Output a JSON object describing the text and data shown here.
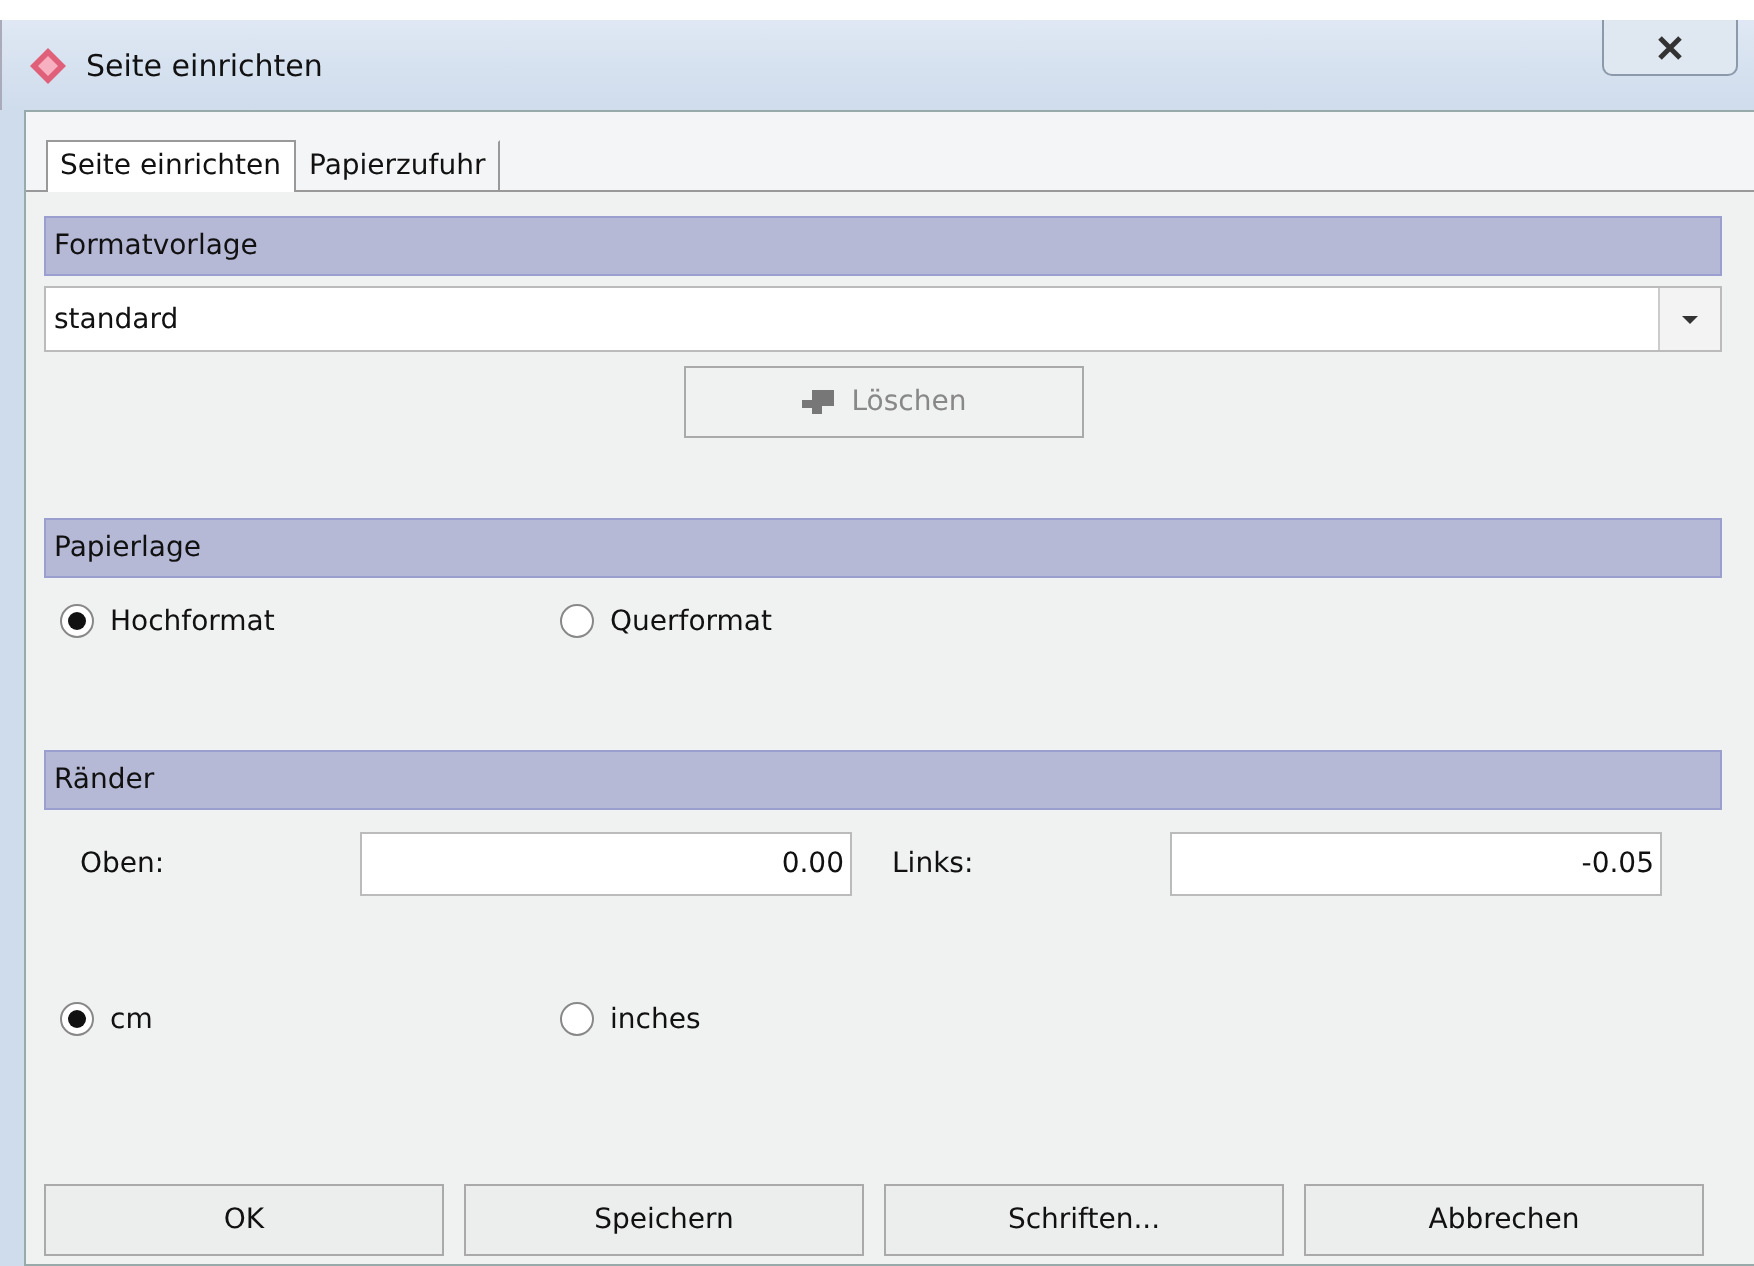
{
  "window": {
    "title": "Seite einrichten"
  },
  "tabs": [
    {
      "label": "Seite einrichten",
      "selected": true
    },
    {
      "label": "Papierzufuhr",
      "selected": false
    }
  ],
  "format": {
    "heading": "Formatvorlage",
    "value": "standard",
    "delete_button": {
      "label": "Löschen",
      "disabled": true
    }
  },
  "orientation": {
    "heading": "Papierlage",
    "options": [
      {
        "label": "Hochformat",
        "selected": true
      },
      {
        "label": "Querformat",
        "selected": false
      }
    ]
  },
  "margins": {
    "heading": "Ränder",
    "fields": [
      {
        "label": "Oben:",
        "value": "0.00"
      },
      {
        "label": "Links:",
        "value": "-0.05"
      }
    ],
    "units": [
      {
        "label": "cm",
        "selected": true
      },
      {
        "label": "inches",
        "selected": false
      }
    ]
  },
  "buttons": [
    "OK",
    "Speichern",
    "Schriften...",
    "Abbrechen"
  ]
}
